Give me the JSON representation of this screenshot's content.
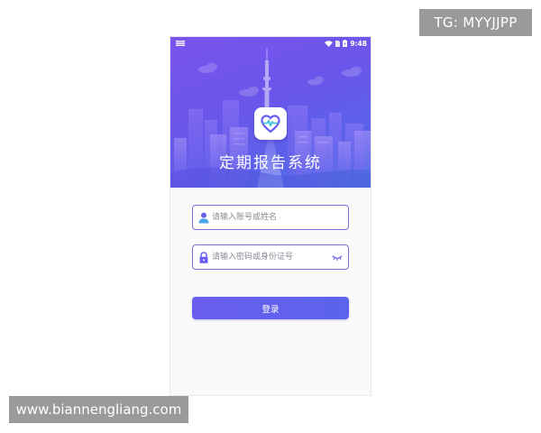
{
  "watermarks": {
    "tg": "TG: MYYJJPP",
    "site": "www.biannengliang.com"
  },
  "status_bar": {
    "time": "9:48",
    "icons": [
      "menu-icon",
      "wifi-icon",
      "sim-icon",
      "battery-icon"
    ]
  },
  "app": {
    "title": "定期报告系统",
    "logo_icon": "heart-pulse-icon"
  },
  "login_form": {
    "account": {
      "placeholder": "请输入账号或姓名",
      "value": "",
      "icon": "user-icon"
    },
    "password": {
      "placeholder": "请输入密码或身份证号",
      "value": "",
      "icon": "lock-icon",
      "toggle_icon": "eye-closed-icon"
    },
    "submit_label": "登录"
  },
  "colors": {
    "primary": "#6a5ef0",
    "hero_start": "#7a55ee",
    "hero_end": "#4c74ea",
    "field_border": "#7b6fd4"
  }
}
